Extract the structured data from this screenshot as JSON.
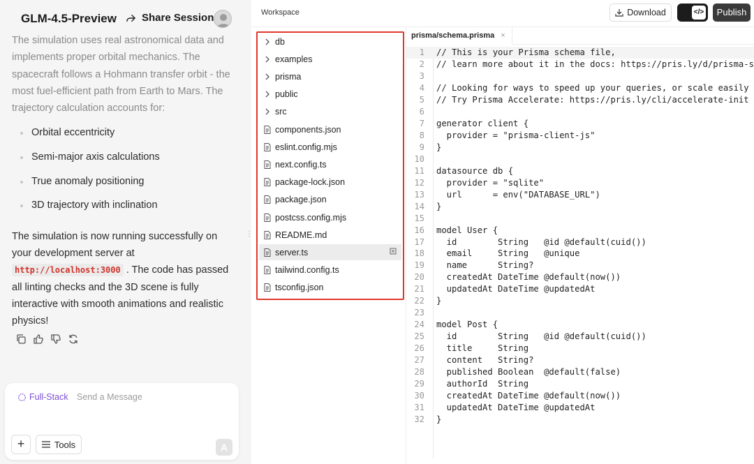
{
  "left_panel": {
    "model_title": "GLM-4.5-Preview",
    "share_label": "Share Session",
    "paragraph_1": "The simulation uses real astronomical data and implements proper orbital mechanics. The spacecraft follows a Hohmann transfer orbit - the most fuel-efficient path from Earth to Mars. The trajectory calculation accounts for:",
    "bullets": [
      "Orbital eccentricity",
      "Semi-major axis calculations",
      "True anomaly positioning",
      "3D trajectory with inclination"
    ],
    "paragraph_2_before": "The simulation is now running successfully on your development server at ",
    "paragraph_2_code": "http://localhost:3000",
    "paragraph_2_after": " . The code has passed all linting checks and the 3D scene is fully interactive with smooth animations and realistic physics!",
    "composer": {
      "mode_label": "Full-Stack",
      "placeholder": "Send a Message",
      "tools_label": "Tools",
      "plus_label": "+",
      "send_label": "A"
    }
  },
  "workspace": {
    "title": "Workspace",
    "download_label": "Download",
    "publish_label": "Publish",
    "toggle_icon": "</>"
  },
  "file_tree": [
    {
      "name": "db",
      "kind": "folder"
    },
    {
      "name": "examples",
      "kind": "folder"
    },
    {
      "name": "prisma",
      "kind": "folder"
    },
    {
      "name": "public",
      "kind": "folder"
    },
    {
      "name": "src",
      "kind": "folder"
    },
    {
      "name": "components.json",
      "kind": "file"
    },
    {
      "name": "eslint.config.mjs",
      "kind": "file"
    },
    {
      "name": "next.config.ts",
      "kind": "file"
    },
    {
      "name": "package-lock.json",
      "kind": "file"
    },
    {
      "name": "package.json",
      "kind": "file"
    },
    {
      "name": "postcss.config.mjs",
      "kind": "file"
    },
    {
      "name": "README.md",
      "kind": "file"
    },
    {
      "name": "server.ts",
      "kind": "file",
      "selected": true
    },
    {
      "name": "tailwind.config.ts",
      "kind": "file"
    },
    {
      "name": "tsconfig.json",
      "kind": "file"
    }
  ],
  "editor": {
    "tab_label": "prisma/schema.prisma",
    "tab_close": "×",
    "lines": [
      "// This is your Prisma schema file,",
      "// learn more about it in the docs: https://pris.ly/d/prisma-schema",
      "",
      "// Looking for ways to speed up your queries, or scale easily with your serverless or edge functions?",
      "// Try Prisma Accelerate: https://pris.ly/cli/accelerate-init",
      "",
      "generator client {",
      "  provider = \"prisma-client-js\"",
      "}",
      "",
      "datasource db {",
      "  provider = \"sqlite\"",
      "  url      = env(\"DATABASE_URL\")",
      "}",
      "",
      "model User {",
      "  id        String   @id @default(cuid())",
      "  email     String   @unique",
      "  name      String?",
      "  createdAt DateTime @default(now())",
      "  updatedAt DateTime @updatedAt",
      "}",
      "",
      "model Post {",
      "  id        String   @id @default(cuid())",
      "  title     String",
      "  content   String?",
      "  published Boolean  @default(false)",
      "  authorId  String",
      "  createdAt DateTime @default(now())",
      "  updatedAt DateTime @updatedAt",
      "}"
    ]
  },
  "icons": {
    "share": "share-arrow-icon",
    "copy": "copy-icon",
    "like": "thumbs-up-icon",
    "dislike": "thumbs-down-icon",
    "regenerate": "refresh-icon",
    "download": "download-icon",
    "tools": "menu-icon",
    "folder": "chevron-right-icon",
    "file": "file-icon",
    "mode": "full-stack-icon"
  },
  "colors": {
    "code_red": "#d0332b",
    "mode_purple": "#7b4fd6",
    "tree_highlight_border": "#e0372d",
    "publish_bg": "#3a3a3a"
  }
}
